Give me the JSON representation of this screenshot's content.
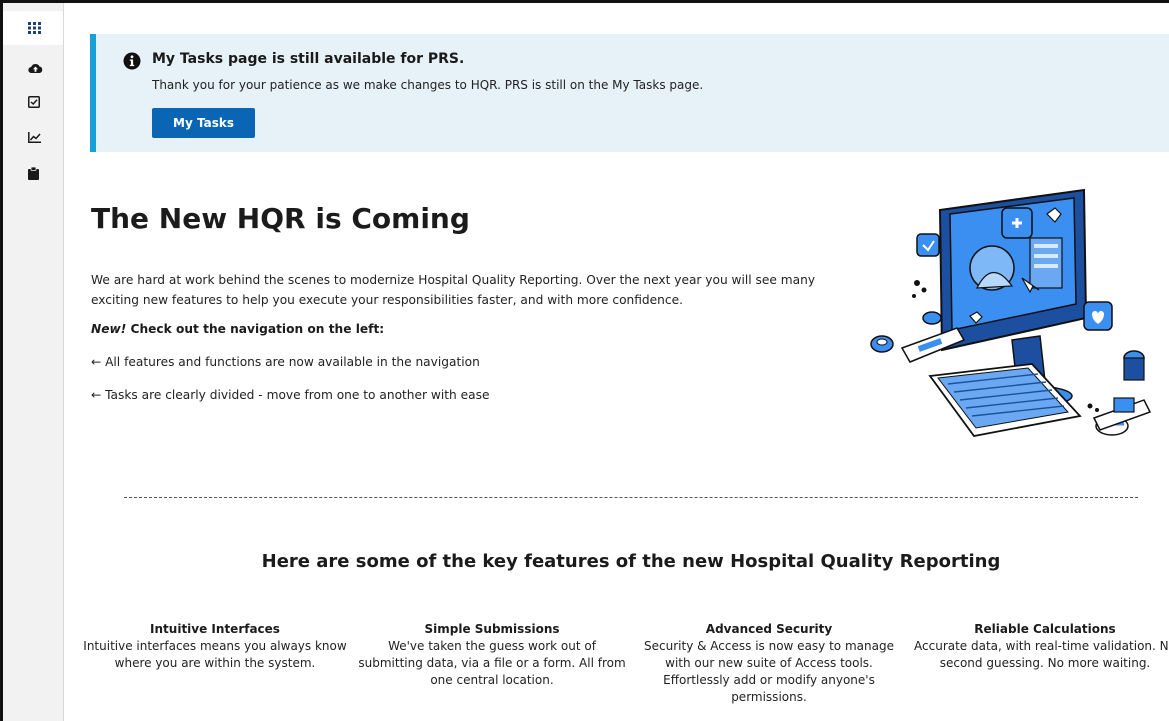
{
  "banner": {
    "title": "My Tasks page is still available for PRS.",
    "message": "Thank you for your patience as we make changes to HQR. PRS is still on the My Tasks page.",
    "button_label": "My Tasks"
  },
  "hero": {
    "title": "The New HQR is Coming",
    "intro": "We are hard at work behind the scenes to modernize Hospital Quality Reporting. Over the next year you will see many exciting new features to help you execute your responsibilities faster, and with more confidence.",
    "nav_note_new": "New!",
    "nav_note_text": " Check out the navigation on the left:",
    "bullets": [
      "← All features and functions are now available in the navigation",
      "← Tasks are clearly divided - move from one to another with ease"
    ]
  },
  "features": {
    "heading": "Here are some of the key features of the new Hospital Quality Reporting",
    "items": [
      {
        "title": "Intuitive Interfaces",
        "text": "Intuitive interfaces means you always know where you are within the system."
      },
      {
        "title": "Simple Submissions",
        "text": "We've taken the guess work out of submitting data, via a file or a form. All from one central location."
      },
      {
        "title": "Advanced Security",
        "text": "Security & Access is now easy to manage with our new suite of Access tools. Effortlessly add or modify anyone's permissions."
      },
      {
        "title": "Reliable Calculations",
        "text": "Accurate data, with real-time validation. No second guessing. No more waiting."
      }
    ]
  },
  "sidebar": {
    "icons": [
      "dashboard-grid-icon",
      "cloud-upload-icon",
      "checkbox-icon",
      "chart-icon",
      "clipboard-icon"
    ]
  },
  "colors": {
    "accent": "#0a66b5",
    "banner_bg": "#e6f1f8",
    "banner_border": "#1aa0d8",
    "illustration_blue": "#2f86e6"
  }
}
